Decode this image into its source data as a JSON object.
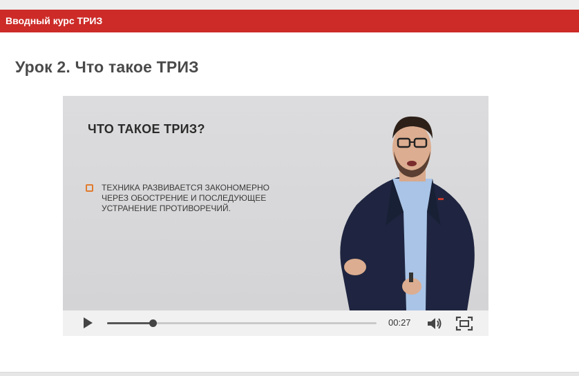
{
  "course": {
    "title": "Вводный курс ТРИЗ"
  },
  "lesson": {
    "title": "Урок 2. Что такое ТРИЗ"
  },
  "video": {
    "slide_title": "ЧТО ТАКОЕ ТРИЗ?",
    "slide_bullet": "ТЕХНИКА РАЗВИВАЕТСЯ ЗАКОНОМЕРНО ЧЕРЕЗ ОБОСТРЕНИЕ И ПОСЛЕДУЮЩЕЕ УСТРАНЕНИЕ ПРОТИВОРЕЧИЙ.",
    "current_time": "00:27",
    "progress_fraction": 0.17,
    "colors": {
      "header": "#cd2b28",
      "bullet": "#e07b2e"
    },
    "icons": {
      "play": "play-icon",
      "volume": "volume-icon",
      "fullscreen": "fullscreen-icon"
    }
  }
}
